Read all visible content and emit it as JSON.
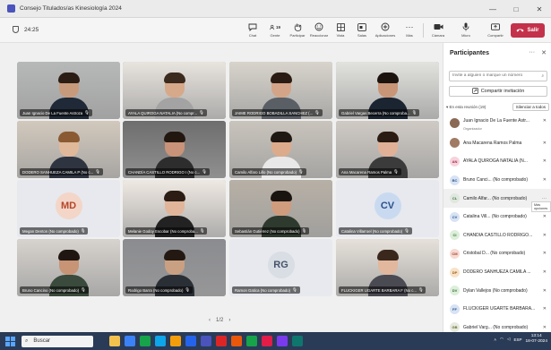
{
  "window": {
    "title": "Consejo Titulados/as Kinesiología 2024",
    "controls": [
      "—",
      "□",
      "✕"
    ]
  },
  "toolbar": {
    "timer": "24:25",
    "buttons": [
      {
        "id": "chat",
        "label": "Chat",
        "icon": "chat-icon"
      },
      {
        "id": "people",
        "label": "Gente",
        "icon": "people-icon",
        "badge": "19"
      },
      {
        "id": "raise",
        "label": "Participar",
        "icon": "hand-icon"
      },
      {
        "id": "react",
        "label": "Reaccionar",
        "icon": "smile-icon"
      },
      {
        "id": "view",
        "label": "Vista",
        "icon": "grid-icon"
      },
      {
        "id": "rooms",
        "label": "Salas",
        "icon": "rooms-icon"
      },
      {
        "id": "apps",
        "label": "Aplicaciones",
        "icon": "plus-icon"
      },
      {
        "id": "more",
        "label": "Más",
        "icon": "more-icon"
      },
      {
        "id": "camera",
        "label": "Cámara",
        "icon": "camera-icon"
      },
      {
        "id": "mic",
        "label": "Micro",
        "icon": "mic-icon"
      },
      {
        "id": "share",
        "label": "Compartir",
        "icon": "share-icon"
      }
    ],
    "leave_label": "Salir"
  },
  "colors": {
    "accent": "#4b53bc",
    "leave": "#c4314b",
    "taskbar": "#2a3b57"
  },
  "tiles": [
    {
      "name": "Juan Ignacio De La Fuente Astroza",
      "type": "video",
      "skin": "#c89a7c",
      "hair": "#2b1d14",
      "shirt": "#1f2937",
      "bg": "#b7b9b8"
    },
    {
      "name": "AYALA QUIROGA NATALIA (No compr...",
      "type": "video",
      "skin": "#d6a98a",
      "hair": "#3b2a1e",
      "shirt": "#a3a3a3",
      "bg": "#e8e4de"
    },
    {
      "name": "JAIME RODRIGO BOBADILLA SANCHEZ (...",
      "type": "video",
      "skin": "#d4a488",
      "hair": "#2a1c14",
      "shirt": "#5a5f66",
      "bg": "#d8d4cc"
    },
    {
      "name": "Gabriel Vargas Becerra (No comproba...",
      "type": "video",
      "skin": "#c99577",
      "hair": "#1c130e",
      "shirt": "#1b2431",
      "bg": "#e2e2de"
    },
    {
      "name": "DODERO SANHUEZA CAMILA P (No c...",
      "type": "video",
      "skin": "#e0b89a",
      "hair": "#8a5a33",
      "shirt": "#2e3440",
      "bg": "#d2c9bd"
    },
    {
      "name": "CHANDÍA CASTILLO RODRIGO I (No c...",
      "type": "video",
      "skin": "#c89378",
      "hair": "#22170f",
      "shirt": "#2d2d2d",
      "bg": "#6e6e6e"
    },
    {
      "name": "Camilo Alfaro Lillo (No comprobado)",
      "type": "video",
      "skin": "#dcab8c",
      "hair": "#1e1712",
      "shirt": "#e8e8e8",
      "bg": "#c9c4bc"
    },
    {
      "name": "Ana Macarena Ramos Palma",
      "type": "video",
      "skin": "#e0b197",
      "hair": "#2a1b13",
      "shirt": "#3b3b3b",
      "bg": "#cfcac4"
    },
    {
      "name": "Megan Denton (No comprobado)",
      "type": "avatar",
      "initials": "MD",
      "avatar_bg": "#f3d6c8",
      "avatar_fg": "#b5462a"
    },
    {
      "name": "Melanie Godoy Escobar (No comproba...",
      "type": "video",
      "skin": "#e1b59a",
      "hair": "#2b1d14",
      "shirt": "#222222",
      "bg": "#efe9e2"
    },
    {
      "name": "Sebastián Gutiérrez (No comprobado)",
      "type": "video",
      "skin": "#cf9c7e",
      "hair": "#1a1410",
      "shirt": "#2f3a2e",
      "bg": "#b7b0a6"
    },
    {
      "name": "Catalina Villarroel (No comprobado)",
      "type": "avatar",
      "initials": "CV",
      "avatar_bg": "#c9daf0",
      "avatar_fg": "#2c4f8a"
    },
    {
      "name": "Bruno Cancino (No comprobado)",
      "type": "video",
      "skin": "#c79475",
      "hair": "#1f1611",
      "shirt": "#3a4a3c",
      "bg": "#d7d3ce"
    },
    {
      "name": "Rodrigo Barra (No comprobado)",
      "type": "video",
      "skin": "#caa083",
      "hair": "#241912",
      "shirt": "#2a2f36",
      "bg": "#8b8c90"
    },
    {
      "name": "Ramon Gatica (No comprobado)",
      "type": "avatar",
      "initials": "RG",
      "avatar_bg": "#d9dde4",
      "avatar_fg": "#44546a"
    },
    {
      "name": "FLUCKIGER UGARTE BARBARA F (No c...",
      "type": "video",
      "skin": "#e1b79e",
      "hair": "#3a281c",
      "shirt": "#4a4a52",
      "bg": "#e6e1da"
    }
  ],
  "pager": {
    "prev": "‹",
    "label": "1/2",
    "next": "›"
  },
  "participants": {
    "title": "Participantes",
    "invite_placeholder": "Invite a alguien o marque un número",
    "share_label": "Compartir invitación",
    "section_label": "En esta reunión (19)",
    "mute_all_label": "Silenciar a todos",
    "tooltip": "Más opciones",
    "list": [
      {
        "name": "Juan Ignacio De La Fuente Astr...",
        "role": "Organizador",
        "initials": "JI",
        "bg": "#8a6a55",
        "fg": "#ffffff",
        "photo": true
      },
      {
        "name": "Ana Macarena Ramos Palma",
        "role": "",
        "initials": "AR",
        "bg": "#a07a62",
        "fg": "#ffffff",
        "photo": true
      },
      {
        "name": "AYALA QUIROGA NATALIA (N...",
        "role": "",
        "initials": "AN",
        "bg": "#f6d3dc",
        "fg": "#a4264a",
        "photo": false
      },
      {
        "name": "Bruno Canci... (No comprobado)",
        "role": "",
        "initials": "BC",
        "bg": "#d7e3f4",
        "fg": "#2c4f8a",
        "photo": false
      },
      {
        "name": "Camilo Alfar... (No comprobado)",
        "role": "",
        "initials": "CL",
        "bg": "#dfe7de",
        "fg": "#3d6b3a",
        "photo": false,
        "highlight": true
      },
      {
        "name": "Catalina Vill... (No comprobado)",
        "role": "",
        "initials": "CV",
        "bg": "#d7e3f4",
        "fg": "#2c4f8a",
        "photo": false
      },
      {
        "name": "CHANDÍA CASTILLO RODRIGO...",
        "role": "",
        "initials": "CI",
        "bg": "#dcefd9",
        "fg": "#3d6b3a",
        "photo": false
      },
      {
        "name": "Cristobal D... (No comprobado)",
        "role": "",
        "initials": "CM",
        "bg": "#f6d9d2",
        "fg": "#a34127",
        "photo": false
      },
      {
        "name": "DODERO SANHUEZA CAMILA ...",
        "role": "",
        "initials": "DP",
        "bg": "#f8e2c8",
        "fg": "#9a5a14",
        "photo": false
      },
      {
        "name": "Dylan Vallejos (No comprobado)",
        "role": "",
        "initials": "DV",
        "bg": "#dcefd9",
        "fg": "#3d6b3a",
        "photo": false
      },
      {
        "name": "FLUCKIGER UGARTE BARBARA...",
        "role": "",
        "initials": "FF",
        "bg": "#d7e3f4",
        "fg": "#2c4f8a",
        "photo": false
      },
      {
        "name": "Gabriel Varg... (No comprobado)",
        "role": "",
        "initials": "GB",
        "bg": "#e7eadd",
        "fg": "#5a6b2a",
        "photo": false
      }
    ]
  },
  "taskbar": {
    "search_label": "Buscar",
    "lang": "ESP",
    "time": "13:14",
    "date": "18-07-2024",
    "apps": [
      "#f2c14e",
      "#3b82f6",
      "#16a34a",
      "#0ea5e9",
      "#f59e0b",
      "#2563eb",
      "#4b53bc",
      "#dc2626",
      "#ea580c",
      "#16a34a",
      "#e11d48",
      "#7c3aed",
      "#0f766e"
    ]
  }
}
